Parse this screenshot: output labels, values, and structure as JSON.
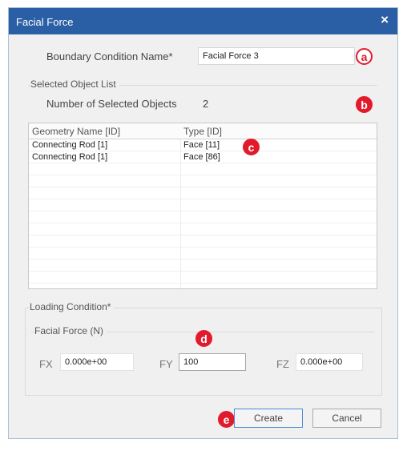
{
  "window": {
    "title": "Facial Force",
    "close_glyph": "×"
  },
  "boundary": {
    "label": "Boundary Condition Name*",
    "value": "Facial Force 3"
  },
  "selected_group": {
    "legend": "Selected Object List",
    "count_label": "Number of Selected Objects",
    "count_value": "2"
  },
  "table": {
    "columns": [
      "Geometry Name [ID]",
      "Type [ID]"
    ],
    "rows": [
      [
        "Connecting Rod [1]",
        "Face [11]"
      ],
      [
        "Connecting Rod [1]",
        "Face [86]"
      ]
    ]
  },
  "loading": {
    "legend": "Loading Condition*",
    "sublegend": "Facial Force (N)",
    "fx_label": "FX",
    "fx_value": "0.000e+00",
    "fy_label": "FY",
    "fy_value": "100",
    "fz_label": "FZ",
    "fz_value": "0.000e+00"
  },
  "buttons": {
    "create": "Create",
    "cancel": "Cancel"
  },
  "annotations": {
    "a": "a",
    "b": "b",
    "c": "c",
    "d": "d",
    "e": "e"
  },
  "colors": {
    "titlebar": "#2a5fa5",
    "annotation": "#e21b2c",
    "background": "#f0f0f0",
    "primary_border": "#4a8bd6"
  }
}
